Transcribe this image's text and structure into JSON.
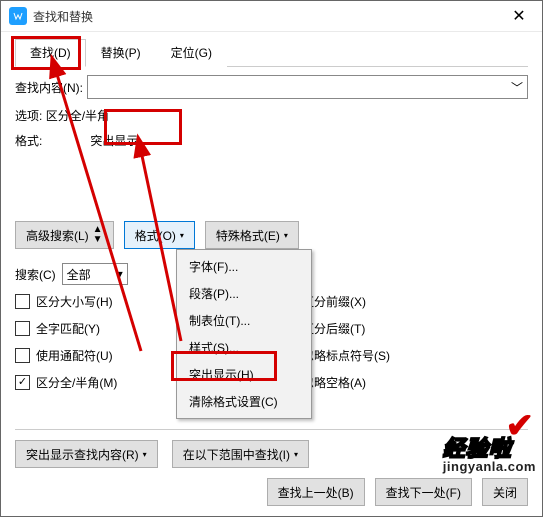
{
  "window": {
    "title": "查找和替换",
    "close": "✕"
  },
  "tabs": {
    "find": "查找(D)",
    "replace": "替换(P)",
    "goto": "定位(G)"
  },
  "labels": {
    "content": "查找内容(N):",
    "options": "选项:",
    "format": "格式:",
    "options_value": "区分全/半角",
    "format_value": "突出显示",
    "search": "搜索(C)",
    "search_scope": "全部"
  },
  "buttons": {
    "advanced": "高级搜索(L)",
    "format_btn": "格式(O)",
    "special": "特殊格式(E)",
    "highlight_search": "突出显示查找内容(R)",
    "search_in": "在以下范围中查找(I)",
    "find_prev": "查找上一处(B)",
    "find_next": "查找下一处(F)",
    "close": "关闭"
  },
  "checkboxes": {
    "case": "区分大小写(H)",
    "whole": "全字匹配(Y)",
    "wildcard": "使用通配符(U)",
    "fullhalf": "区分全/半角(M)",
    "prefix": "区分前缀(X)",
    "suffix": "区分后缀(T)",
    "punct": "忽略标点符号(S)",
    "space": "忽略空格(A)"
  },
  "menu": {
    "font": "字体(F)...",
    "para": "段落(P)...",
    "tab": "制表位(T)...",
    "style": "样式(S)...",
    "highlight": "突出显示(H)",
    "clear": "清除格式设置(C)"
  },
  "icons": {
    "dropdown": "▾",
    "updown": "▲▼",
    "selectdown": "﹀",
    "checked": "✓"
  },
  "watermark": {
    "l1": "经验啦",
    "l2": "jingyanla.com"
  }
}
